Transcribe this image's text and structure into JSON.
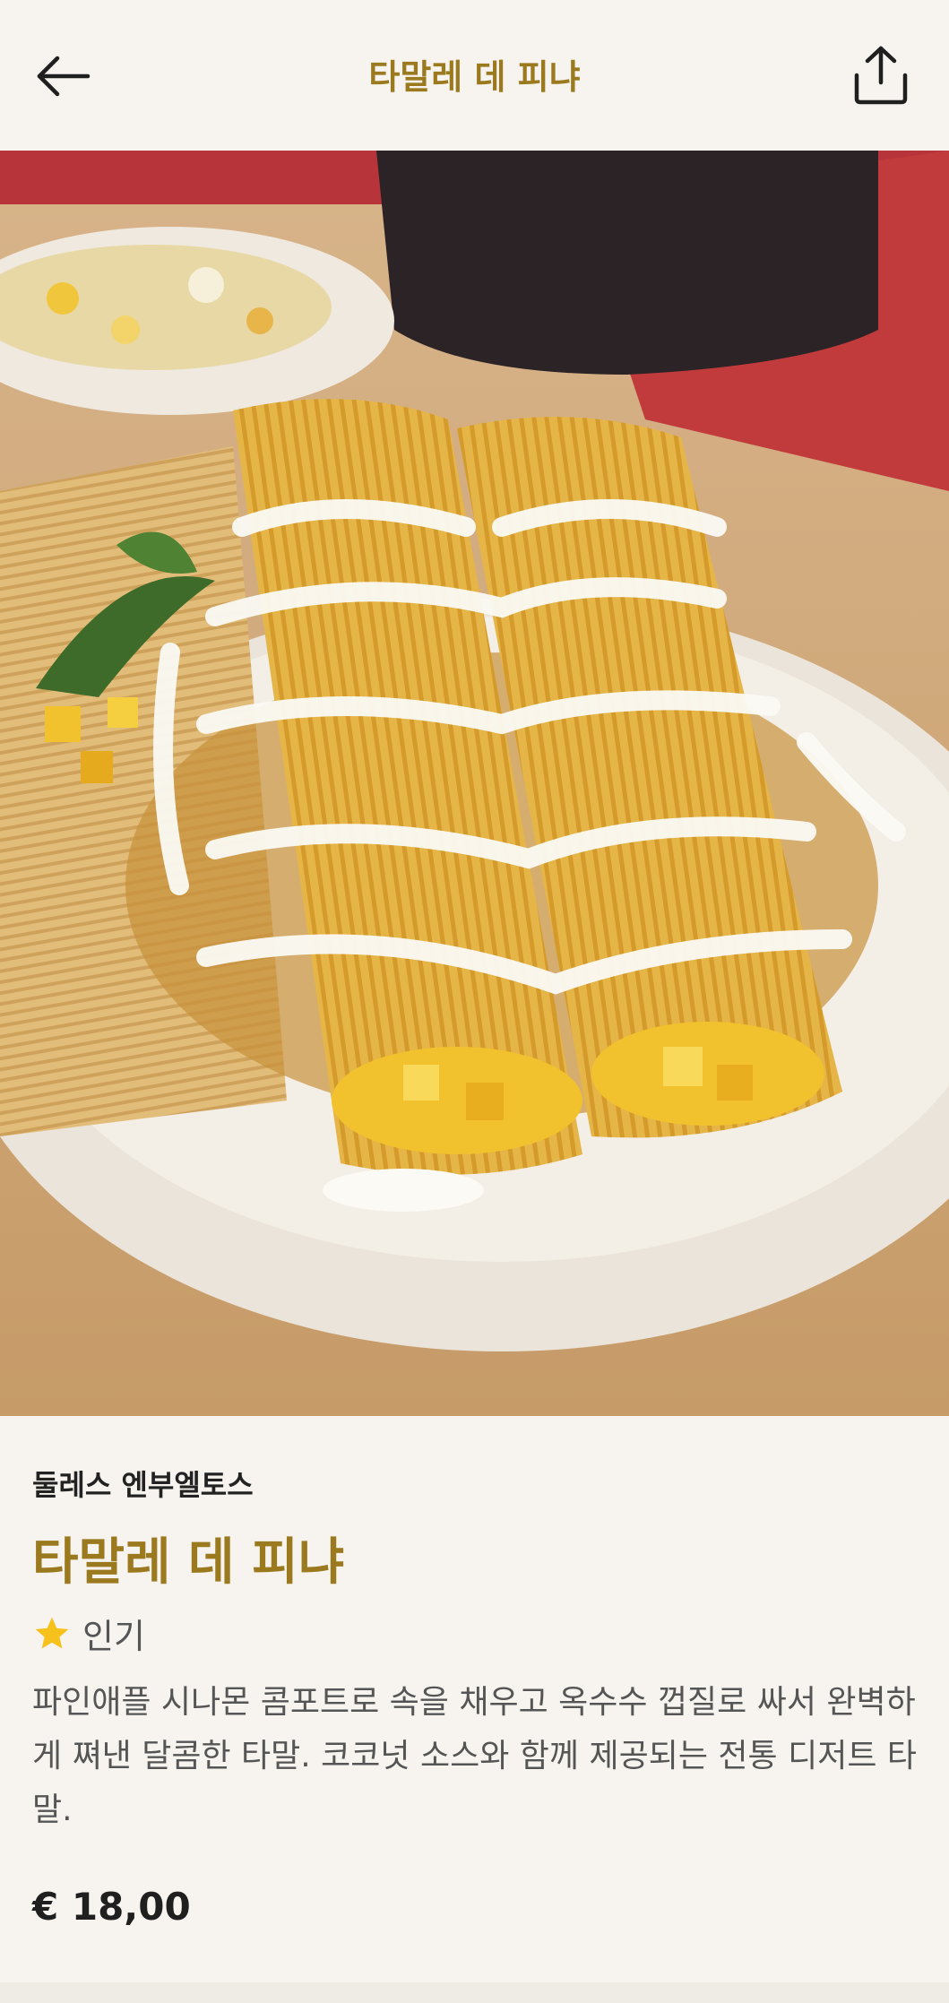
{
  "header": {
    "title": "타말레 데 피냐",
    "back_icon": "arrow-left-icon",
    "share_icon": "share-upload-icon"
  },
  "hero": {
    "image": "photo-tamales-with-cream-sauce"
  },
  "product": {
    "category": "둘레스 엔부엘토스",
    "name": "타말레 데 피냐",
    "badge": {
      "icon": "star-icon",
      "label": "인기",
      "color": "#f5c11a"
    },
    "description": "파인애플 시나몬 콤포트로 속을 채우고 옥수수 껍질로 싸서 완벽하게 쪄낸 달콤한 타말. 코코넛 소스와 함께 제공되는 전통 디저트 타말.",
    "price": "€ 18,00"
  },
  "theme": {
    "accent": "#9b7a1f",
    "background": "#f7f4ef"
  }
}
